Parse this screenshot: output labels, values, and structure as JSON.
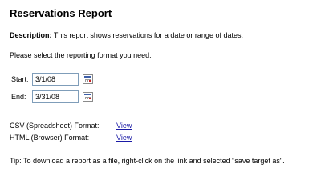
{
  "report": {
    "title": "Reservations Report",
    "description_label": "Description:",
    "description_text": " This report shows reservations for a date or range of dates.",
    "prompt": "Please select the reporting format you need:"
  },
  "dates": {
    "start_label": "Start:",
    "start_value": "3/1/08",
    "end_label": "End:",
    "end_value": "3/31/08"
  },
  "formats": {
    "csv_label": "CSV (Spreadsheet) Format:",
    "csv_link": "View",
    "html_label": "HTML (Browser) Format:",
    "html_link": "View"
  },
  "tip": "Tip: To download a report as a file, right-click on the link and selected \"save target as\".",
  "icons": {
    "calendar": "calendar-icon"
  }
}
